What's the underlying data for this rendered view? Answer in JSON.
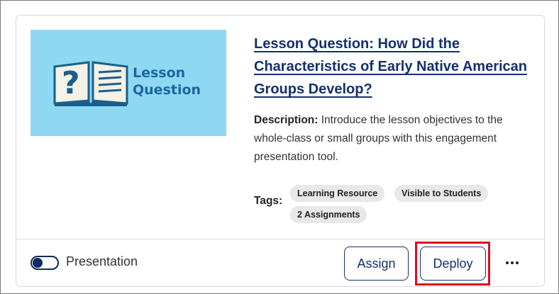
{
  "card": {
    "thumbnail": {
      "line1": "Lesson",
      "line2": "Question",
      "icon": "open-book-question-icon"
    },
    "title": "Lesson Question: How Did the Characteristics of Early Native American Groups Develop?",
    "description_label": "Description:",
    "description": " Introduce the lesson objectives to the whole-class or small groups with this engagement presentation tool.",
    "tags_label": "Tags:",
    "tags": [
      "Learning Resource",
      "Visible to Students",
      "2 Assignments"
    ]
  },
  "footer": {
    "toggle_label": "Presentation",
    "assign_label": "Assign",
    "deploy_label": "Deploy",
    "more_icon": "more-horizontal-icon"
  },
  "colors": {
    "accent": "#14306e",
    "thumbnail_bg": "#8fd8f3",
    "highlight": "#d8101c"
  }
}
